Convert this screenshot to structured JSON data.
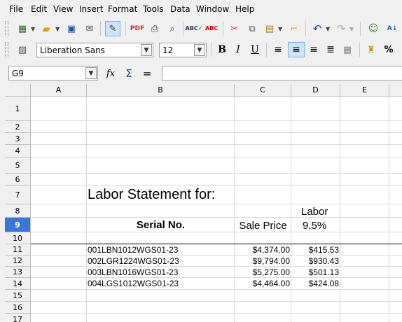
{
  "menu": [
    "File",
    "Edit",
    "View",
    "Insert",
    "Format",
    "Tools",
    "Data",
    "Window",
    "Help"
  ],
  "toolbar": {
    "icons": [
      "new-icon",
      "open-icon",
      "save-icon",
      "email-icon",
      "edit-mode-icon",
      "pdf-icon",
      "print-icon",
      "print-preview-icon",
      "spellcheck-icon",
      "autospell-icon",
      "cut-icon",
      "copy-icon",
      "paste-icon",
      "clone-icon",
      "undo-icon",
      "redo-icon",
      "navigator-icon",
      "sort-icon"
    ]
  },
  "format": {
    "font_name": "Liberation Sans",
    "font_size": "12",
    "bold": "B",
    "italic": "I",
    "underline": "U",
    "percent": "%"
  },
  "formula": {
    "name_box": "G9",
    "fx": "fx",
    "sum": "Σ",
    "equals": "=",
    "content": ""
  },
  "columns": [
    "A",
    "B",
    "C",
    "D",
    "E"
  ],
  "rows": [
    "1",
    "2",
    "3",
    "4",
    "5",
    "6",
    "7",
    "8",
    "9",
    "10",
    "11",
    "12",
    "13",
    "14",
    "15",
    "16",
    "17"
  ],
  "sheet": {
    "title": "Labor Statement for:",
    "labor_header": "Labor",
    "serial_header": "Serial No.",
    "sale_price_header": "Sale Price",
    "labor_rate": "9.5%",
    "records": [
      {
        "serial": "001LBN1012WGS01-23",
        "price": "$4,374.00",
        "labor": "$415.53"
      },
      {
        "serial": "002LGR1224WGS01-23",
        "price": "$9,794.00",
        "labor": "$930.43"
      },
      {
        "serial": "003LBN1016WGS01-23",
        "price": "$5,275.00",
        "labor": "$501.13"
      },
      {
        "serial": "004LGS1012WGS01-23",
        "price": "$4,464.00",
        "labor": "$424.08"
      }
    ]
  },
  "colors": {
    "accent": "#3a76d8"
  }
}
